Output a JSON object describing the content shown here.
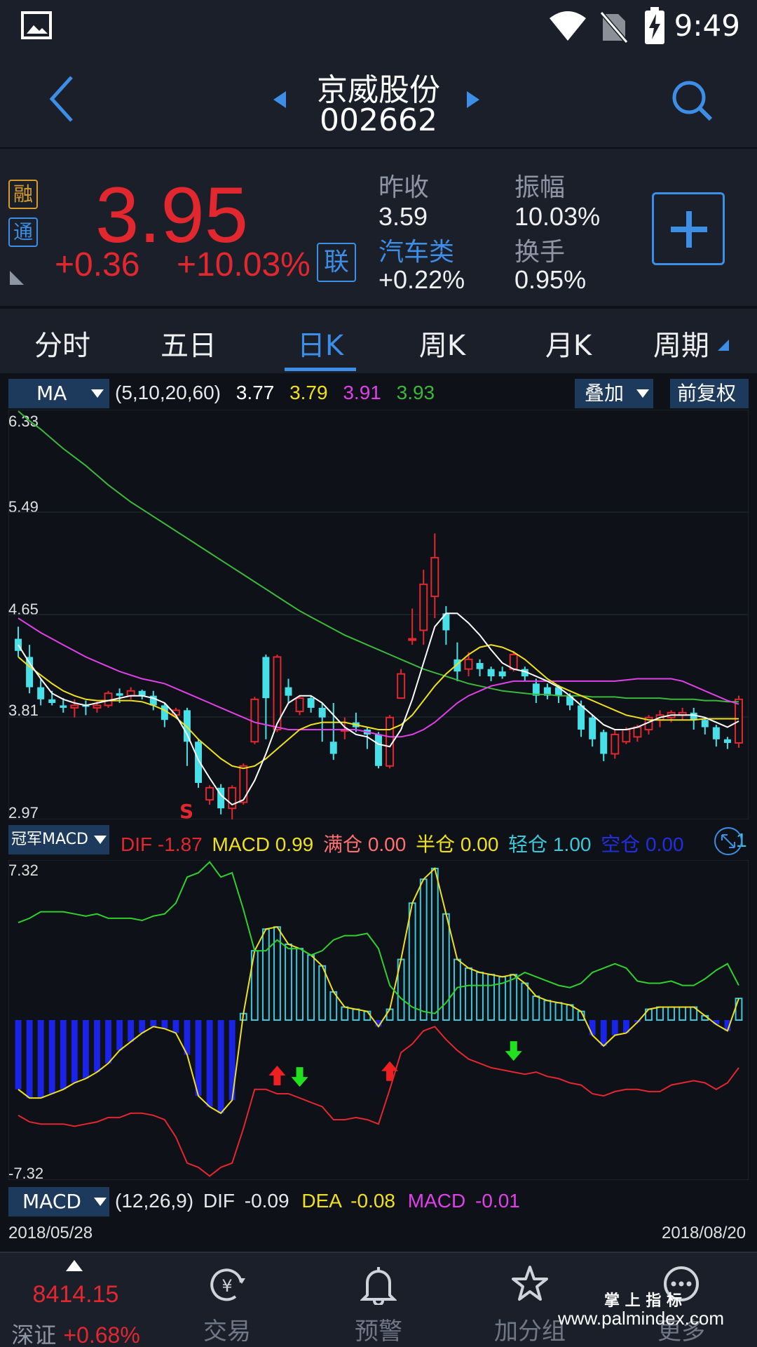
{
  "status": {
    "time": "9:49"
  },
  "header": {
    "name": "京威股份",
    "code": "002662"
  },
  "badges": {
    "rong": "融",
    "tong": "通",
    "lian": "联"
  },
  "quote": {
    "price": "3.95",
    "change": "+0.36",
    "change_pct": "+10.03%",
    "prev_close_label": "昨收",
    "prev_close": "3.59",
    "amplitude_label": "振幅",
    "amplitude": "10.03%",
    "sector_label": "汽车类",
    "sector_chg": "+0.22%",
    "turnover_label": "换手",
    "turnover": "0.95%"
  },
  "tabs": [
    "分时",
    "五日",
    "日K",
    "周K",
    "月K",
    "周期"
  ],
  "ma_bar": {
    "select": "MA",
    "params": "(5,10,20,60)",
    "v5": "3.77",
    "v10": "3.79",
    "v20": "3.91",
    "v60": "3.93",
    "overlay": "叠加",
    "adjust": "前复权"
  },
  "price_axis": [
    "6.33",
    "5.49",
    "4.65",
    "3.81",
    "2.97"
  ],
  "signal_s": "S",
  "macd_custom": {
    "select": "冠军MACD",
    "dif_label": "DIF",
    "dif": "-1.87",
    "macd_label": "MACD",
    "macd": "0.99",
    "full_label": "满仓",
    "full": "0.00",
    "half_label": "半仓",
    "half": "0.00",
    "light_label": "轻仓",
    "light": "1.00",
    "empty_label": "空仓",
    "empty": "0.00",
    "tail": "1"
  },
  "macd_axis": [
    "7.32",
    "-7.32"
  ],
  "macd_bar": {
    "select": "MACD",
    "params": "(12,26,9)",
    "dif_label": "DIF",
    "dif": "-0.09",
    "dea_label": "DEA",
    "dea": "-0.08",
    "macd_label": "MACD",
    "macd": "-0.01"
  },
  "dates": {
    "start": "2018/05/28",
    "end": "2018/08/20"
  },
  "bottom_nav": {
    "index_value": "8414.15",
    "index_name": "深证",
    "index_chg": "+0.68%",
    "items": [
      "交易",
      "预警",
      "加分组",
      "更多"
    ]
  },
  "watermark": {
    "line1": "掌 上 指 标",
    "line2": "www.palmindex.com"
  },
  "colors": {
    "up": "#e3272f",
    "accent": "#3c8ee6",
    "ma5": "#ffffff",
    "ma10": "#f0e020",
    "ma20": "#e040e8",
    "ma60": "#3cb83c"
  },
  "chart_data": {
    "type": "candlestick",
    "price_range": [
      2.97,
      6.33
    ],
    "macd_range": [
      -7.32,
      7.32
    ],
    "candles": [
      [
        4.45,
        4.35,
        4.55,
        4.3
      ],
      [
        4.3,
        4.05,
        4.4,
        4.0
      ],
      [
        4.05,
        3.95,
        4.12,
        3.9
      ],
      [
        3.95,
        3.92,
        4.02,
        3.9
      ],
      [
        3.9,
        3.88,
        3.96,
        3.84
      ],
      [
        3.88,
        3.9,
        3.95,
        3.8
      ],
      [
        3.9,
        3.89,
        3.94,
        3.82
      ],
      [
        3.88,
        3.9,
        3.93,
        3.84
      ],
      [
        3.9,
        4.0,
        4.02,
        3.88
      ],
      [
        4.0,
        3.98,
        4.04,
        3.92
      ],
      [
        3.98,
        4.02,
        4.05,
        3.95
      ],
      [
        4.02,
        3.98,
        4.03,
        3.95
      ],
      [
        3.98,
        3.9,
        4.02,
        3.86
      ],
      [
        3.9,
        3.78,
        3.92,
        3.72
      ],
      [
        3.82,
        3.86,
        3.88,
        3.8
      ],
      [
        3.86,
        3.6,
        3.88,
        3.4
      ],
      [
        3.6,
        3.26,
        3.62,
        3.22
      ],
      [
        3.12,
        3.22,
        3.24,
        3.08
      ],
      [
        3.22,
        3.05,
        3.25,
        3.0
      ],
      [
        3.05,
        3.22,
        3.24,
        2.95
      ],
      [
        3.1,
        3.4,
        3.42,
        3.08
      ],
      [
        3.6,
        3.95,
        3.97,
        3.58
      ],
      [
        4.3,
        3.96,
        4.32,
        3.62
      ],
      [
        3.7,
        4.3,
        4.32,
        3.68
      ],
      [
        4.05,
        3.98,
        4.12,
        3.92
      ],
      [
        3.85,
        3.96,
        3.98,
        3.82
      ],
      [
        3.96,
        3.88,
        3.98,
        3.84
      ],
      [
        3.88,
        3.8,
        3.92,
        3.6
      ],
      [
        3.6,
        3.5,
        3.92,
        3.45
      ],
      [
        3.7,
        3.7,
        3.8,
        3.62
      ],
      [
        3.76,
        3.72,
        3.84,
        3.68
      ],
      [
        3.7,
        3.66,
        3.72,
        3.54
      ],
      [
        3.66,
        3.4,
        3.68,
        3.38
      ],
      [
        3.4,
        3.8,
        3.82,
        3.38
      ],
      [
        3.96,
        4.16,
        4.2,
        3.96
      ],
      [
        4.45,
        4.45,
        4.7,
        4.4
      ],
      [
        4.52,
        4.9,
        5.02,
        4.4
      ],
      [
        4.8,
        5.12,
        5.32,
        4.62
      ],
      [
        4.66,
        4.52,
        4.72,
        4.4
      ],
      [
        4.28,
        4.18,
        4.42,
        4.1
      ],
      [
        4.2,
        4.28,
        4.34,
        4.14
      ],
      [
        4.25,
        4.2,
        4.28,
        4.14
      ],
      [
        4.2,
        4.14,
        4.22,
        4.1
      ],
      [
        4.18,
        4.14,
        4.22,
        4.12
      ],
      [
        4.2,
        4.32,
        4.35,
        4.18
      ],
      [
        4.2,
        4.14,
        4.22,
        4.1
      ],
      [
        4.08,
        3.98,
        4.12,
        3.92
      ],
      [
        4.05,
        3.98,
        4.08,
        3.95
      ],
      [
        4.05,
        3.98,
        4.07,
        3.92
      ],
      [
        3.98,
        3.9,
        4.0,
        3.86
      ],
      [
        3.9,
        3.7,
        3.94,
        3.64
      ],
      [
        3.8,
        3.62,
        3.82,
        3.56
      ],
      [
        3.68,
        3.5,
        3.7,
        3.44
      ],
      [
        3.5,
        3.66,
        3.7,
        3.46
      ],
      [
        3.6,
        3.7,
        3.72,
        3.58
      ],
      [
        3.64,
        3.72,
        3.74,
        3.6
      ],
      [
        3.7,
        3.8,
        3.82,
        3.66
      ],
      [
        3.78,
        3.82,
        3.86,
        3.72
      ],
      [
        3.8,
        3.84,
        3.86,
        3.76
      ],
      [
        3.82,
        3.84,
        3.88,
        3.78
      ],
      [
        3.84,
        3.78,
        3.88,
        3.7
      ],
      [
        3.78,
        3.72,
        3.8,
        3.66
      ],
      [
        3.72,
        3.62,
        3.74,
        3.56
      ],
      [
        3.62,
        3.59,
        3.64,
        3.54
      ],
      [
        3.59,
        3.95,
        3.98,
        3.55
      ]
    ],
    "ma5": [
      4.4,
      4.25,
      4.12,
      4.0,
      3.95,
      3.92,
      3.9,
      3.92,
      3.94,
      3.96,
      3.98,
      3.98,
      3.96,
      3.92,
      3.82,
      3.66,
      3.45,
      3.3,
      3.16,
      3.08,
      3.12,
      3.28,
      3.5,
      3.75,
      3.92,
      3.98,
      3.98,
      3.92,
      3.82,
      3.72,
      3.66,
      3.64,
      3.58,
      3.56,
      3.7,
      3.95,
      4.25,
      4.55,
      4.66,
      4.66,
      4.58,
      4.48,
      4.36,
      4.25,
      4.2,
      4.18,
      4.14,
      4.1,
      4.05,
      3.98,
      3.9,
      3.82,
      3.74,
      3.7,
      3.7,
      3.72,
      3.76,
      3.8,
      3.82,
      3.82,
      3.82,
      3.8,
      3.76,
      3.72,
      3.77
    ],
    "ma10": [
      4.3,
      4.22,
      4.15,
      4.08,
      4.02,
      3.98,
      3.95,
      3.94,
      3.94,
      3.94,
      3.94,
      3.93,
      3.9,
      3.86,
      3.8,
      3.72,
      3.62,
      3.54,
      3.46,
      3.4,
      3.38,
      3.4,
      3.46,
      3.54,
      3.62,
      3.7,
      3.74,
      3.76,
      3.76,
      3.76,
      3.74,
      3.72,
      3.7,
      3.7,
      3.74,
      3.82,
      3.94,
      4.06,
      4.16,
      4.24,
      4.32,
      4.38,
      4.4,
      4.38,
      4.34,
      4.28,
      4.2,
      4.12,
      4.06,
      4.02,
      3.98,
      3.94,
      3.9,
      3.86,
      3.82,
      3.8,
      3.78,
      3.78,
      3.78,
      3.78,
      3.78,
      3.79,
      3.79,
      3.79,
      3.79
    ],
    "ma20": [
      4.62,
      4.56,
      4.5,
      4.45,
      4.4,
      4.35,
      4.3,
      4.26,
      4.22,
      4.18,
      4.15,
      4.12,
      4.1,
      4.08,
      4.04,
      4.0,
      3.96,
      3.92,
      3.88,
      3.84,
      3.8,
      3.76,
      3.74,
      3.72,
      3.7,
      3.7,
      3.7,
      3.7,
      3.7,
      3.7,
      3.7,
      3.68,
      3.66,
      3.64,
      3.64,
      3.66,
      3.7,
      3.76,
      3.84,
      3.92,
      3.98,
      4.02,
      4.06,
      4.08,
      4.1,
      4.1,
      4.1,
      4.1,
      4.1,
      4.1,
      4.1,
      4.1,
      4.1,
      4.1,
      4.11,
      4.12,
      4.12,
      4.12,
      4.12,
      4.1,
      4.06,
      4.02,
      3.98,
      3.94,
      3.91
    ],
    "ma60": [
      6.33,
      6.25,
      6.18,
      6.1,
      6.02,
      5.95,
      5.88,
      5.8,
      5.72,
      5.65,
      5.58,
      5.52,
      5.46,
      5.4,
      5.34,
      5.28,
      5.22,
      5.16,
      5.1,
      5.04,
      4.98,
      4.92,
      4.86,
      4.8,
      4.74,
      4.68,
      4.63,
      4.58,
      4.53,
      4.48,
      4.44,
      4.4,
      4.36,
      4.32,
      4.28,
      4.24,
      4.2,
      4.17,
      4.14,
      4.11,
      4.08,
      4.06,
      4.04,
      4.02,
      4.01,
      4.0,
      3.99,
      3.99,
      3.98,
      3.98,
      3.98,
      3.97,
      3.97,
      3.97,
      3.96,
      3.96,
      3.96,
      3.96,
      3.95,
      3.95,
      3.95,
      3.94,
      3.94,
      3.93,
      3.93
    ],
    "macd_hist": [
      -3.2,
      -3.6,
      -3.6,
      -3.4,
      -3.2,
      -2.9,
      -2.7,
      -2.4,
      -2.0,
      -1.4,
      -1.0,
      -0.6,
      -0.3,
      -0.4,
      -0.6,
      -1.6,
      -3.5,
      -4.0,
      -4.3,
      -3.7,
      0.3,
      3.2,
      4.2,
      4.3,
      3.5,
      3.3,
      3.0,
      2.5,
      1.3,
      0.6,
      0.5,
      0.4,
      -0.3,
      0.5,
      2.8,
      5.4,
      6.5,
      7.0,
      4.9,
      2.8,
      2.4,
      2.2,
      2.1,
      2.0,
      2.1,
      1.7,
      1.1,
      0.9,
      0.8,
      0.7,
      0.4,
      -0.7,
      -1.2,
      -0.7,
      -0.6,
      -0.1,
      0.5,
      0.6,
      0.6,
      0.6,
      0.6,
      0.2,
      -0.2,
      -0.5,
      1.0
    ],
    "macd_green": [
      4.5,
      4.7,
      5.0,
      5.0,
      5.0,
      4.9,
      4.8,
      4.9,
      4.7,
      4.7,
      4.7,
      4.6,
      4.8,
      4.9,
      5.4,
      6.6,
      6.8,
      7.3,
      6.6,
      6.8,
      5.1,
      3.2,
      3.2,
      3.7,
      3.3,
      3.3,
      3.0,
      3.2,
      3.7,
      3.9,
      3.9,
      4.0,
      3.3,
      1.6,
      1.0,
      0.6,
      0.4,
      0.3,
      0.8,
      1.5,
      1.6,
      1.6,
      1.6,
      1.7,
      1.9,
      2.2,
      2.0,
      1.8,
      1.6,
      1.5,
      1.7,
      2.2,
      2.4,
      2.6,
      2.4,
      1.8,
      1.7,
      1.7,
      1.8,
      1.6,
      1.6,
      1.9,
      2.3,
      2.6,
      1.6
    ],
    "macd_red": [
      -4.4,
      -4.7,
      -4.8,
      -4.8,
      -4.8,
      -4.9,
      -4.8,
      -4.7,
      -4.5,
      -4.5,
      -4.3,
      -4.3,
      -4.4,
      -4.6,
      -5.4,
      -6.6,
      -6.8,
      -7.2,
      -6.8,
      -6.6,
      -5.0,
      -3.2,
      -3.2,
      -3.4,
      -3.4,
      -3.6,
      -3.8,
      -4.0,
      -4.6,
      -4.6,
      -4.5,
      -4.6,
      -4.8,
      -3.2,
      -1.5,
      -1.1,
      -0.5,
      -0.3,
      -0.9,
      -1.4,
      -1.8,
      -2.0,
      -2.2,
      -2.3,
      -2.4,
      -2.5,
      -2.4,
      -2.6,
      -2.7,
      -2.9,
      -3.0,
      -3.4,
      -3.5,
      -3.3,
      -3.2,
      -3.2,
      -3.3,
      -3.3,
      -3.0,
      -2.9,
      -2.8,
      -2.9,
      -3.2,
      -2.9,
      -2.2
    ],
    "arrows_up": [
      23,
      33
    ],
    "arrows_down": [
      25,
      44
    ],
    "signal_s_index": 14
  }
}
